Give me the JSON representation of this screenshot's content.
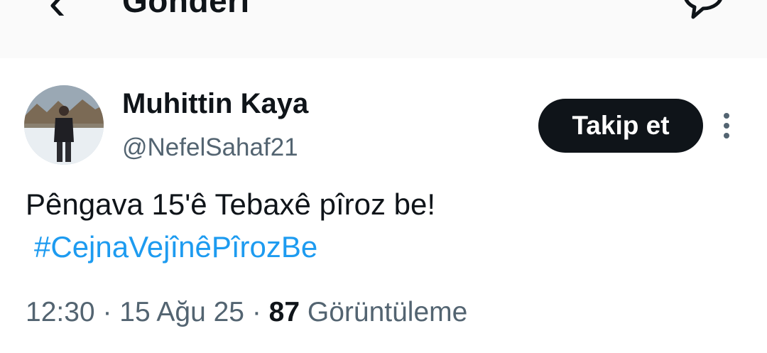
{
  "header": {
    "title": "Gönderi",
    "icons": {
      "back": "arrow-left-icon",
      "reply": "reply-icon"
    }
  },
  "author": {
    "name": "Muhittin Kaya",
    "handle": "@NefelSahaf21",
    "avatar": "avatar-photo"
  },
  "actions": {
    "follow_label": "Takip et",
    "more": "more-vertical-icon"
  },
  "tweet": {
    "text": "Pêngava 15'ê Tebaxê pîroz be!",
    "hashtag": "#CejnaVejînêPîrozBe"
  },
  "meta": {
    "time": "12:30",
    "sep1": "·",
    "date": "15 Ağu 25",
    "sep2": "·",
    "views_count": "87",
    "views_label": "Görüntüleme"
  },
  "colors": {
    "text": "#0f1419",
    "secondary": "#536471",
    "link": "#1d9bf0",
    "header_bg": "#fafafa",
    "button_bg": "#0f1419"
  }
}
